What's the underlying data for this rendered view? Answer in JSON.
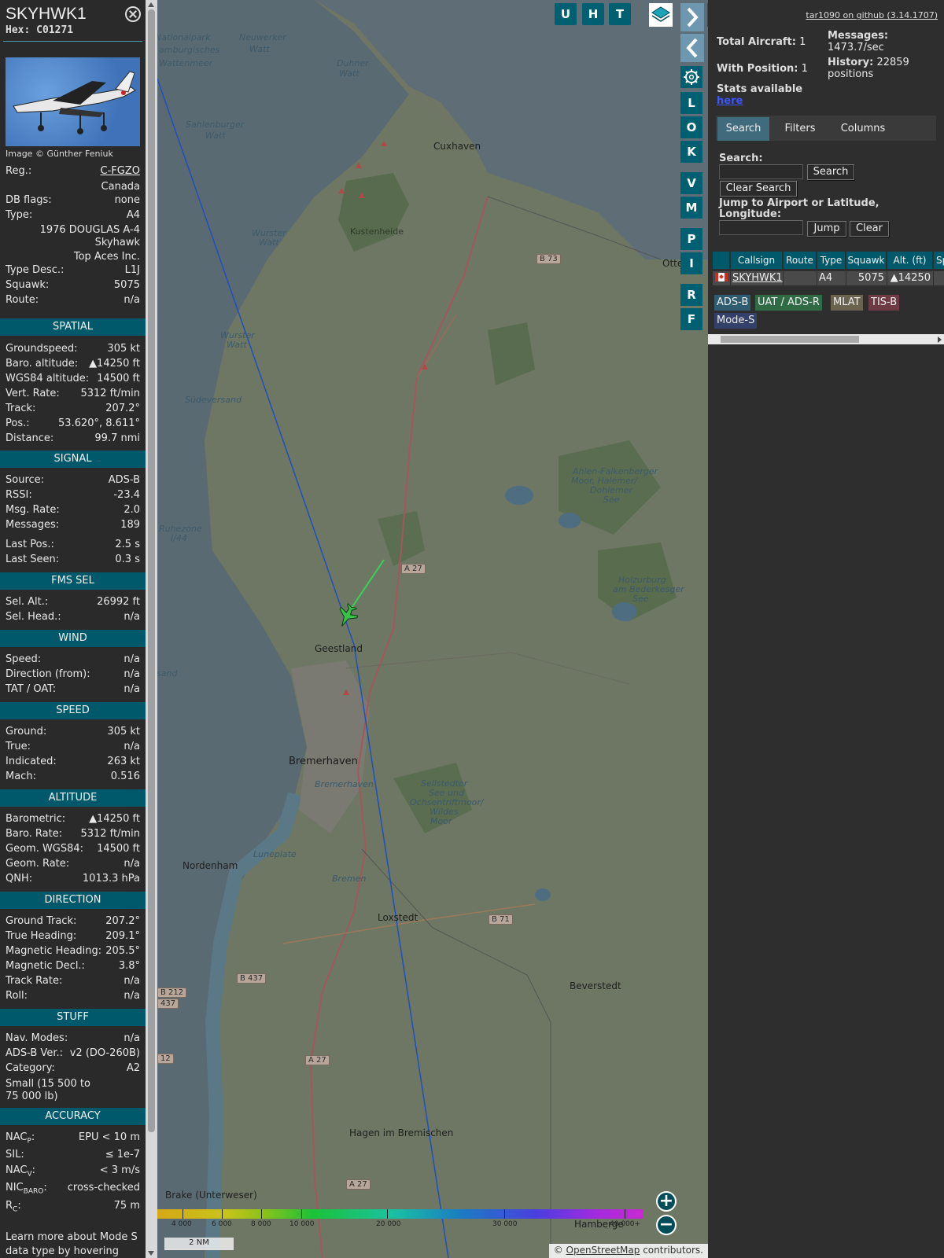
{
  "detail": {
    "callsign": "SKYHWK1",
    "hex_label": "Hex:",
    "hex": "C01271",
    "image_credit": "Image © Günther Feniuk",
    "info": {
      "reg_label": "Reg.:",
      "reg": "C-FGZO",
      "country": "Canada",
      "dbflags_label": "DB flags:",
      "dbflags": "none",
      "type_label": "Type:",
      "type": "A4",
      "model_line1": "1976 DOUGLAS A-4",
      "model_line2": "Skyhawk",
      "operator": "Top Aces Inc.",
      "typedesc_label": "Type Desc.:",
      "typedesc": "L1J",
      "squawk_label": "Squawk:",
      "squawk": "5075",
      "route_label": "Route:",
      "route": "n/a"
    },
    "spatial": {
      "header": "SPATIAL",
      "gs_label": "Groundspeed:",
      "gs": "305 kt",
      "baro_label": "Baro. altitude:",
      "baro": "▲14250 ft",
      "wgs_label": "WGS84 altitude:",
      "wgs": "14500 ft",
      "vr_label": "Vert. Rate:",
      "vr": "5312 ft/min",
      "track_label": "Track:",
      "track": "207.2°",
      "pos_label": "Pos.:",
      "pos": "53.620°, 8.611°",
      "dist_label": "Distance:",
      "dist": "99.7 nmi"
    },
    "signal": {
      "header": "SIGNAL",
      "source_label": "Source:",
      "source": "ADS-B",
      "rssi_label": "RSSI:",
      "rssi": "-23.4",
      "msgrate_label": "Msg. Rate:",
      "msgrate": "2.0",
      "messages_label": "Messages:",
      "messages": "189",
      "lastpos_label": "Last Pos.:",
      "lastpos": "2.5 s",
      "lastseen_label": "Last Seen:",
      "lastseen": "0.3 s"
    },
    "fms": {
      "header": "FMS SEL",
      "selalt_label": "Sel. Alt.:",
      "selalt": "26992 ft",
      "selhead_label": "Sel. Head.:",
      "selhead": "n/a"
    },
    "wind": {
      "header": "WIND",
      "speed_label": "Speed:",
      "speed": "n/a",
      "dir_label": "Direction (from):",
      "dir": "n/a",
      "tat_label": "TAT / OAT:",
      "tat": "n/a"
    },
    "speed": {
      "header": "SPEED",
      "ground_label": "Ground:",
      "ground": "305 kt",
      "true_label": "True:",
      "true": "n/a",
      "ind_label": "Indicated:",
      "ind": "263 kt",
      "mach_label": "Mach:",
      "mach": "0.516"
    },
    "altitude": {
      "header": "ALTITUDE",
      "baro_label": "Barometric:",
      "baro": "▲14250 ft",
      "barorate_label": "Baro. Rate:",
      "barorate": "5312 ft/min",
      "geom_label": "Geom. WGS84:",
      "geom": "14500 ft",
      "geomrate_label": "Geom. Rate:",
      "geomrate": "n/a",
      "qnh_label": "QNH:",
      "qnh": "1013.3 hPa"
    },
    "direction": {
      "header": "DIRECTION",
      "gtrack_label": "Ground Track:",
      "gtrack": "207.2°",
      "thead_label": "True Heading:",
      "thead": "209.1°",
      "mhead_label": "Magnetic Heading:",
      "mhead": "205.5°",
      "mdecl_label": "Magnetic Decl.:",
      "mdecl": "3.8°",
      "trate_label": "Track Rate:",
      "trate": "n/a",
      "roll_label": "Roll:",
      "roll": "n/a"
    },
    "stuff": {
      "header": "STUFF",
      "nav_label": "Nav. Modes:",
      "nav": "n/a",
      "adsbver_label": "ADS-B Ver.:",
      "adsbver": "v2 (DO-260B)",
      "cat_label": "Category:",
      "cat": "A2",
      "cat_desc_1": "Small (15 500 to",
      "cat_desc_2": "75 000 lb)"
    },
    "accuracy": {
      "header": "ACCURACY",
      "nacp_label": "NAC",
      "nacp_sub": "P",
      "nacp": "EPU < 10 m",
      "sil_label": "SIL:",
      "sil": "≤ 1e-7",
      "nacv_label": "NAC",
      "nacv_sub": "V",
      "nacv": "< 3 m/s",
      "nicbaro_label": "NIC",
      "nicbaro_sub": "BARO",
      "nicbaro": "cross-checked",
      "rc_label": "R",
      "rc_sub": "C",
      "rc": "75 m"
    },
    "footer_1": "Learn more about Mode S",
    "footer_2": "data type by hovering over"
  },
  "map": {
    "buttons": {
      "u": "U",
      "h": "H",
      "t": "T",
      "l": "L",
      "o": "O",
      "k": "K",
      "v": "V",
      "m": "M",
      "p": "P",
      "i": "I",
      "r": "R",
      "f": "F"
    },
    "labels": {
      "nationalpark": "Nationalpark",
      "hamburgisches": "amburgisches",
      "wattenmeer": "Wattenmeer",
      "neuwerker": "Neuwerker",
      "watt1": "Watt",
      "duhner": "Duhner",
      "watt2": "Watt",
      "cuxhaven": "Cuxhaven",
      "sahlenburger": "Sahlenburger",
      "watt3": "Watt",
      "kustenheide": "Kustenheide",
      "wurster1": "Wurster",
      "watt4": "Watt",
      "wurster2": "Wurster",
      "watt5": "Watt",
      "sudeversand": "Südeversand",
      "ruhezone1": "Ruhezone",
      "ruhezone2": "I/44",
      "ahlen1": "Ahlen-Falkenberger",
      "ahlen2": "Moor, Halemer/",
      "ahlen3": "Dohlemer",
      "ahlen4": "See",
      "holz1": "Holzurburg",
      "holz2": "am Bederkesger",
      "holz3": "See",
      "geestland": "Geestland",
      "sand": "sand",
      "bremerhaven": "Bremerhaven",
      "bremerhaven_small": "Bremerhaven",
      "sell1": "Sellstedter",
      "sell2": "See und",
      "sell3": "Ochsentriftmoor/",
      "sell4": "Wildes",
      "sell5": "Moor",
      "nordenham": "Nordenham",
      "luneplate": "Luneplate",
      "bremen": "Bremen",
      "loxstedt": "Loxstedt",
      "beverstedt": "Beverstedt",
      "hagen": "Hagen im Bremischen",
      "brake": "Brake (Unterweser)",
      "otter": "Otter",
      "hamberg": "Hamberge"
    },
    "shields": {
      "b73": "B 73",
      "a27a": "A 27",
      "b71": "B 71",
      "b437": "B 437",
      "b212a": "B 212",
      "b212b": "437",
      "b12": "12",
      "a27b": "A 27",
      "a27c": "A 27"
    },
    "alt_ticks": [
      "4 000",
      "6 000",
      "8 000",
      "10 000",
      "20 000",
      "30 000",
      "40 000+"
    ],
    "scale_label": "2 NM",
    "attribution_prefix": "© ",
    "attribution_link": "OpenStreetMap",
    "attribution_suffix": " contributors."
  },
  "right": {
    "github": "tar1090 on github (3.14.1707)",
    "total_label": "Total Aircraft:",
    "total": "1",
    "withpos_label": "With Position:",
    "withpos": "1",
    "messages_label": "Messages:",
    "messages": "1473.7/sec",
    "history_label": "History:",
    "history_count": "22859",
    "history_unit": "positions",
    "stats_label": "Stats available",
    "stats_link": "here",
    "tabs": {
      "search": "Search",
      "filters": "Filters",
      "columns": "Columns"
    },
    "search_label": "Search:",
    "search_btn": "Search",
    "clear_search_btn": "Clear Search",
    "jump_label_1": "Jump to Airport or Latitude,",
    "jump_label_2": "Longitude:",
    "jump_btn": "Jump",
    "clear_btn": "Clear",
    "table": {
      "headers": [
        "Callsign",
        "Route",
        "Type",
        "Squawk",
        "Alt. (ft)",
        "Sp"
      ],
      "row": {
        "callsign": "SKYHWK1",
        "route": "",
        "type": "A4",
        "squawk": "5075",
        "alt": "▲14250"
      }
    },
    "badges": {
      "adsb": "ADS-B",
      "uat": "UAT / ADS-R",
      "mlat": "MLAT",
      "tisb": "TIS-B",
      "modes": "Mode-S"
    }
  }
}
